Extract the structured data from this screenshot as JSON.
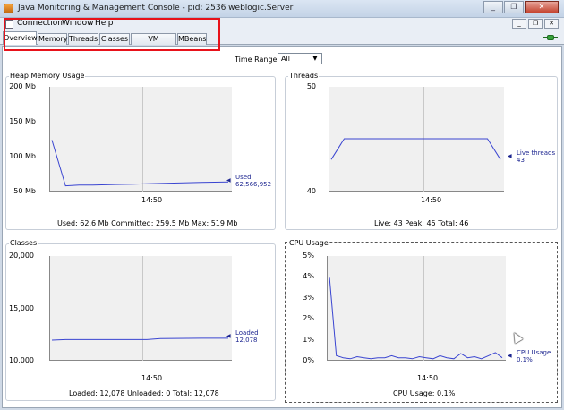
{
  "window": {
    "title": "Java Monitoring & Management Console - pid: 2536 weblogic.Server",
    "minimize": "_",
    "maximize": "❐",
    "close": "✕"
  },
  "menu": [
    {
      "label": "Connection"
    },
    {
      "label": "Window"
    },
    {
      "label": "Help"
    }
  ],
  "mdi": {
    "minimize": "_",
    "restore": "❐",
    "close": "✕"
  },
  "tabs": [
    {
      "label": "Overview",
      "active": true
    },
    {
      "label": "Memory"
    },
    {
      "label": "Threads"
    },
    {
      "label": "Classes"
    },
    {
      "label": "VM Summary"
    },
    {
      "label": "MBeans"
    }
  ],
  "time_range": {
    "label": "Time Range:",
    "value": "All",
    "arrow": "▼"
  },
  "colors": {
    "series": "#3a45d1",
    "legend": "#1d2690",
    "highlight": "#e8121a"
  },
  "panels": {
    "heap": {
      "title": "Heap Memory Usage",
      "yticks": [
        "200 Mb",
        "150 Mb",
        "100 Mb",
        "50 Mb"
      ],
      "xtick": "14:50",
      "legend": {
        "name": "Used",
        "value": "62,566,952"
      },
      "footer": "Used: 62.6 Mb    Committed: 259.5 Mb    Max: 519 Mb"
    },
    "threads": {
      "title": "Threads",
      "yticks": [
        "50",
        "40"
      ],
      "xtick": "14:50",
      "legend": {
        "name": "Live threads",
        "value": "43"
      },
      "footer": "Live: 43    Peak: 45    Total: 46"
    },
    "classes": {
      "title": "Classes",
      "yticks": [
        "20,000",
        "15,000",
        "10,000"
      ],
      "xtick": "14:50",
      "legend": {
        "name": "Loaded",
        "value": "12,078"
      },
      "footer": "Loaded: 12,078    Unloaded: 0    Total: 12,078"
    },
    "cpu": {
      "title": "CPU Usage",
      "yticks": [
        "5%",
        "4%",
        "3%",
        "2%",
        "1%",
        "0%"
      ],
      "xtick": "14:50",
      "legend": {
        "name": "CPU Usage",
        "value": "0.1%"
      },
      "footer": "CPU Usage: 0.1%"
    }
  },
  "chart_data": [
    {
      "type": "line",
      "ylabel": "",
      "ylim": [
        50,
        200
      ],
      "series": [
        {
          "name": "Used",
          "values": [
            123,
            57,
            58,
            58,
            58.5,
            59,
            59.5,
            60,
            60.5,
            61,
            61.5,
            62,
            62.3,
            62.6
          ]
        }
      ]
    },
    {
      "type": "line",
      "ylim": [
        40,
        50
      ],
      "series": [
        {
          "name": "Live threads",
          "values": [
            43,
            45,
            45,
            45,
            45,
            45,
            45,
            45,
            45,
            45,
            45,
            45,
            45,
            43
          ]
        }
      ]
    },
    {
      "type": "line",
      "ylim": [
        10000,
        20000
      ],
      "series": [
        {
          "name": "Loaded",
          "values": [
            11900,
            11950,
            11950,
            11950,
            11950,
            11950,
            11950,
            11950,
            12040,
            12060,
            12070,
            12075,
            12078,
            12078
          ]
        }
      ]
    },
    {
      "type": "line",
      "ylim": [
        0,
        5
      ],
      "series": [
        {
          "name": "CPU Usage",
          "values": [
            4.0,
            0.2,
            0.1,
            0.05,
            0.15,
            0.1,
            0.05,
            0.1,
            0.1,
            0.2,
            0.1,
            0.1,
            0.05,
            0.15,
            0.1,
            0.05,
            0.2,
            0.1,
            0.05,
            0.3,
            0.1,
            0.15,
            0.05,
            0.2,
            0.35,
            0.1
          ]
        }
      ]
    }
  ]
}
